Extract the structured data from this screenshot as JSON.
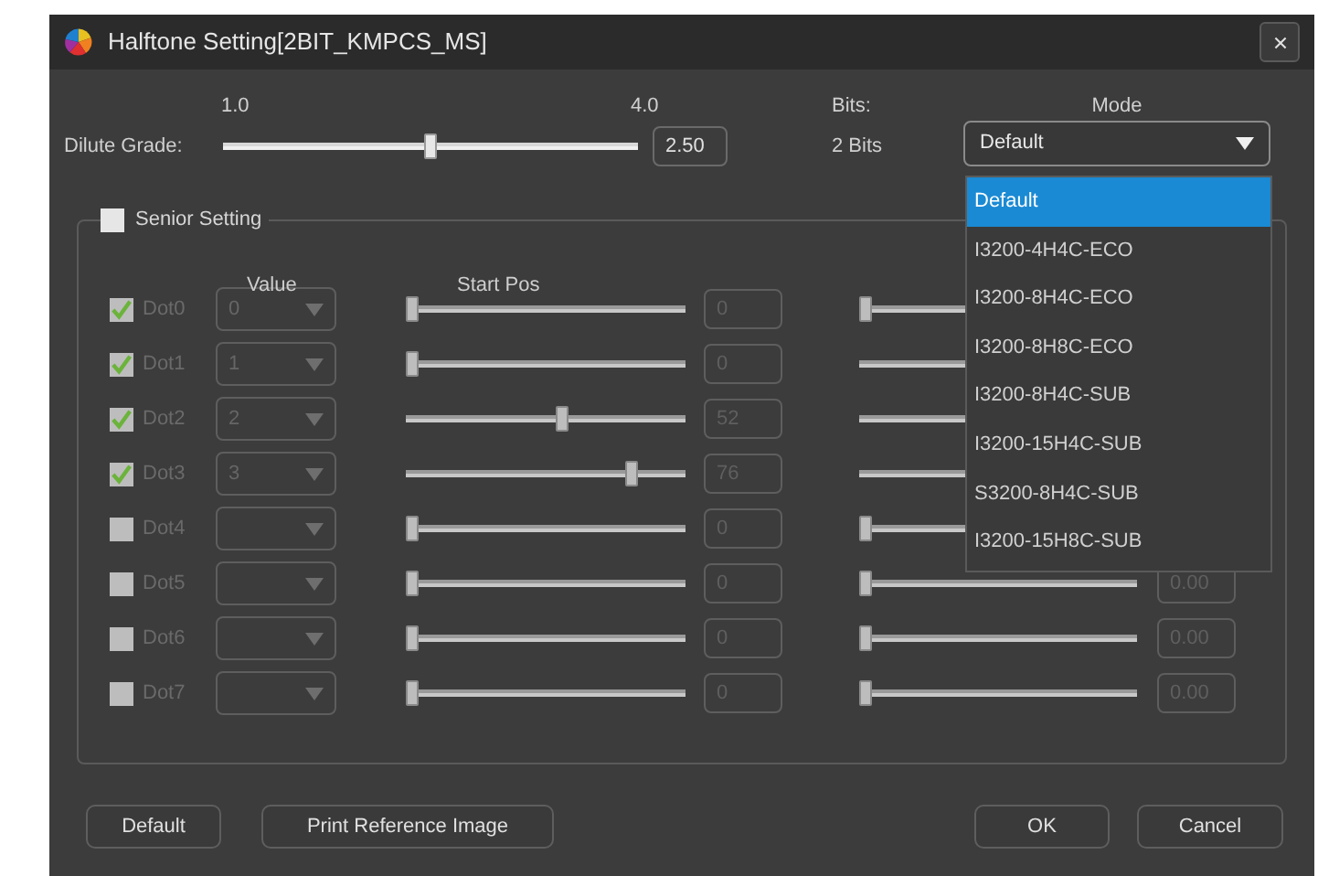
{
  "window": {
    "title": "Halftone Setting[2BIT_KMPCS_MS]"
  },
  "dilute": {
    "label": "Dilute Grade:",
    "min_label": "1.0",
    "max_label": "4.0",
    "level": 0.5,
    "value": "2.50"
  },
  "bits": {
    "label": "Bits:",
    "value": "2 Bits"
  },
  "mode": {
    "label": "Mode",
    "value": "Default",
    "expanded": true,
    "options": [
      {
        "label": "Default",
        "selected": true
      },
      {
        "label": "I3200-4H4C-ECO",
        "selected": false
      },
      {
        "label": "I3200-8H4C-ECO",
        "selected": false
      },
      {
        "label": "I3200-8H8C-ECO",
        "selected": false
      },
      {
        "label": "I3200-8H4C-SUB",
        "selected": false
      },
      {
        "label": "I3200-15H4C-SUB",
        "selected": false
      },
      {
        "label": "S3200-8H4C-SUB",
        "selected": false
      },
      {
        "label": "I3200-15H8C-SUB",
        "selected": false
      }
    ]
  },
  "senior": {
    "label": "Senior Setting",
    "checked": false,
    "columns": [
      "Value",
      "Start Pos"
    ]
  },
  "dots": [
    {
      "label": "Dot0",
      "checked": true,
      "value": "0",
      "start": {
        "level": 0,
        "value": "0"
      },
      "end": {
        "level": 0
      }
    },
    {
      "label": "Dot1",
      "checked": true,
      "value": "1",
      "start": {
        "level": 0,
        "value": "0"
      }
    },
    {
      "label": "Dot2",
      "checked": true,
      "value": "2",
      "start": {
        "level": 0.56,
        "value": "52"
      }
    },
    {
      "label": "Dot3",
      "checked": true,
      "value": "3",
      "start": {
        "level": 0.82,
        "value": "76"
      }
    },
    {
      "label": "Dot4",
      "checked": false,
      "start": {
        "level": 0,
        "value": "0"
      },
      "end": {
        "level": 0
      }
    },
    {
      "label": "Dot5",
      "checked": false,
      "start": {
        "level": 0,
        "value": "0"
      },
      "end": {
        "level": 0,
        "value": "0.00"
      }
    },
    {
      "label": "Dot6",
      "checked": false,
      "start": {
        "level": 0,
        "value": "0"
      },
      "end": {
        "level": 0,
        "value": "0.00"
      }
    },
    {
      "label": "Dot7",
      "checked": false,
      "start": {
        "level": 0,
        "value": "0"
      },
      "end": {
        "level": 0,
        "value": "0.00"
      }
    }
  ],
  "buttons": {
    "left": [
      "Default",
      "Print Reference Image"
    ],
    "right": [
      "OK",
      "Cancel"
    ]
  }
}
